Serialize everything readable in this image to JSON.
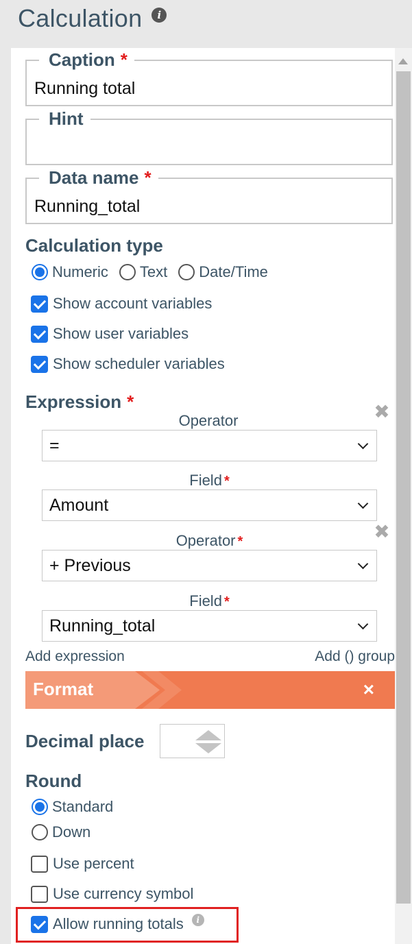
{
  "header": {
    "title": "Calculation",
    "info_icon": "info-icon"
  },
  "fields": {
    "caption": {
      "label": "Caption",
      "required_mark": "*",
      "value": "Running total"
    },
    "hint": {
      "label": "Hint",
      "value": ""
    },
    "data_name": {
      "label": "Data name",
      "required_mark": "*",
      "value": "Running_total"
    }
  },
  "calculation_type": {
    "title": "Calculation type",
    "options": [
      {
        "label": "Numeric",
        "selected": true
      },
      {
        "label": "Text",
        "selected": false
      },
      {
        "label": "Date/Time",
        "selected": false
      }
    ],
    "checkboxes": [
      {
        "label": "Show account variables",
        "checked": true
      },
      {
        "label": "Show user variables",
        "checked": true
      },
      {
        "label": "Show scheduler variables",
        "checked": true
      }
    ]
  },
  "expression": {
    "title": "Expression",
    "required_mark": "*",
    "rows": [
      {
        "label": "Operator",
        "required": "",
        "value": "="
      },
      {
        "label": "Field",
        "required": "*",
        "value": "Amount"
      },
      {
        "label": "Operator",
        "required": "*",
        "value": "+ Previous"
      },
      {
        "label": "Field",
        "required": "*",
        "value": "Running_total"
      }
    ],
    "add_expression": "Add expression",
    "add_group": "Add () group"
  },
  "format": {
    "title": "Format",
    "close": "×",
    "decimal_place_label": "Decimal place",
    "decimal_place_value": "",
    "round_title": "Round",
    "round_options": [
      {
        "label": "Standard",
        "selected": true
      },
      {
        "label": "Down",
        "selected": false
      }
    ],
    "checkboxes": [
      {
        "label": "Use percent",
        "checked": false
      },
      {
        "label": "Use currency symbol",
        "checked": false
      },
      {
        "label": "Allow running totals",
        "checked": true
      }
    ]
  },
  "colors": {
    "accent": "#1a73e8",
    "format_bar": "#f07a50",
    "heading": "#3d5566",
    "required": "#e21d1d",
    "highlight": "#e02020"
  }
}
